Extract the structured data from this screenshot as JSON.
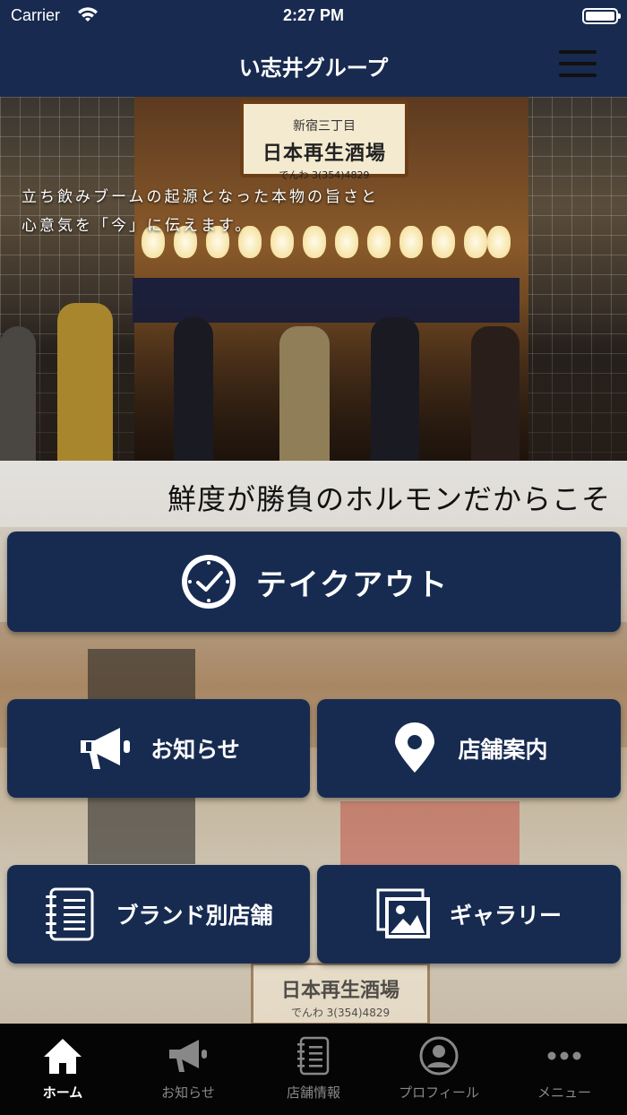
{
  "status_bar": {
    "carrier": "Carrier",
    "time": "2:27 PM"
  },
  "nav": {
    "title": "い志井グループ"
  },
  "hero": {
    "caption_line1": "立ち飲みブームの起源となった本物の旨さと",
    "caption_line2": "心意気を「今」に伝えます。",
    "sign_top": "新宿三丁目",
    "sign_main": "日本再生酒場",
    "sign_phone": "でんわ 3(354)4829"
  },
  "ticker": {
    "text": "鮮度が勝負のホルモンだからこそ"
  },
  "buttons": {
    "takeout": {
      "label": "テイクアウト",
      "icon": "clock-check-icon"
    },
    "news": {
      "label": "お知らせ",
      "icon": "megaphone-icon"
    },
    "store": {
      "label": "店舗案内",
      "icon": "map-pin-icon"
    },
    "brand": {
      "label": "ブランド別店舗",
      "icon": "notebook-icon"
    },
    "gallery": {
      "label": "ギャラリー",
      "icon": "gallery-icon"
    }
  },
  "background_sign": {
    "main": "日本再生酒場",
    "phone": "でんわ 3(354)4829"
  },
  "tabs": [
    {
      "label": "ホーム",
      "icon": "home-icon",
      "active": true
    },
    {
      "label": "お知らせ",
      "icon": "megaphone-icon",
      "active": false
    },
    {
      "label": "店舗情報",
      "icon": "notebook-icon",
      "active": false
    },
    {
      "label": "プロフィール",
      "icon": "profile-icon",
      "active": false
    },
    {
      "label": "メニュー",
      "icon": "more-icon",
      "active": false
    }
  ],
  "colors": {
    "navy": "#172b51",
    "tab_bar": "#050505"
  }
}
